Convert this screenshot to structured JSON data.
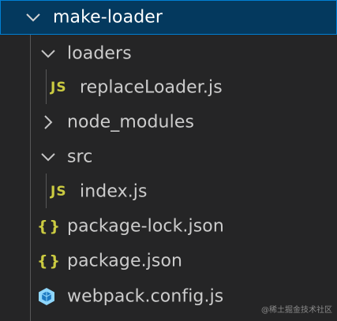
{
  "explorer": {
    "root": {
      "label": "make-loader",
      "expanded": true,
      "icon": "chevron-down-icon"
    },
    "items": [
      {
        "label": "loaders",
        "kind": "folder",
        "expanded": true,
        "icon": "chevron-down-icon"
      },
      {
        "label": "replaceLoader.js",
        "kind": "file",
        "icon": "js-file-icon",
        "badge": "JS"
      },
      {
        "label": "node_modules",
        "kind": "folder",
        "expanded": false,
        "icon": "chevron-right-icon"
      },
      {
        "label": "src",
        "kind": "folder",
        "expanded": true,
        "icon": "chevron-down-icon"
      },
      {
        "label": "index.js",
        "kind": "file",
        "icon": "js-file-icon",
        "badge": "JS"
      },
      {
        "label": "package-lock.json",
        "kind": "file",
        "icon": "json-file-icon",
        "badge": "{}"
      },
      {
        "label": "package.json",
        "kind": "file",
        "icon": "json-file-icon",
        "badge": "{}"
      },
      {
        "label": "webpack.config.js",
        "kind": "file",
        "icon": "webpack-cube-icon"
      }
    ]
  },
  "watermark": "@稀土掘金技术社区",
  "colors": {
    "background": "#252526",
    "selection": "#04395e",
    "selection_border": "#007fd4",
    "js_icon": "#cbcb41",
    "json_icon": "#cbcb41",
    "webpack_icon": "#8ed6fb"
  }
}
